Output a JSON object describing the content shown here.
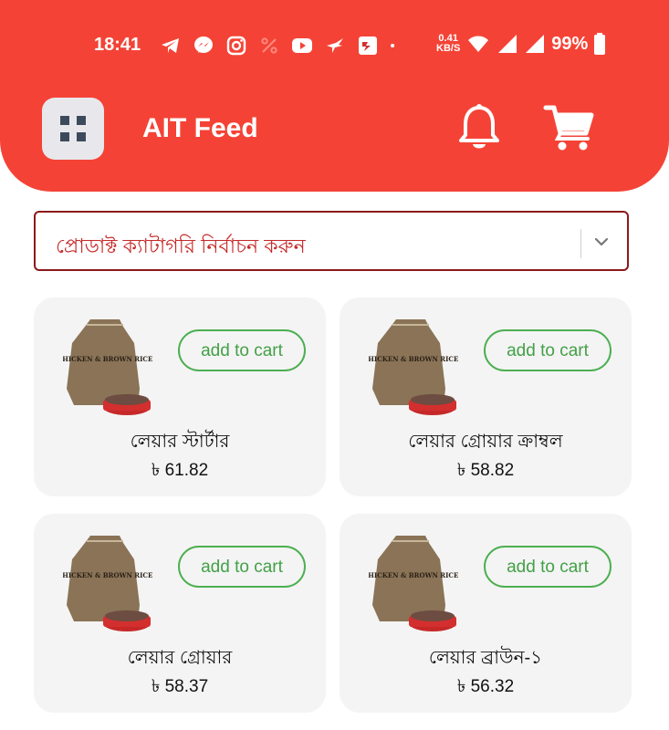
{
  "status_bar": {
    "time": "18:41",
    "net_speed_value": "0.41",
    "net_speed_unit": "KB/S",
    "battery": "99%",
    "icons": [
      "telegram-icon",
      "messenger-icon",
      "instagram-icon",
      "percent-icon",
      "youtube-icon",
      "bird-icon",
      "app-icon",
      "dot-icon",
      "wifi-icon",
      "signal-icon",
      "battery-icon"
    ]
  },
  "header": {
    "title": "AIT Feed",
    "background_color": "#f44336"
  },
  "category": {
    "placeholder": "প্রোডাক্ট ক্যাটাগরি নির্বাচন করুন"
  },
  "products": [
    {
      "name": "লেয়ার স্টার্টার",
      "price": "৳ 61.82",
      "button": "add to cart",
      "bag_text": "CHICKEN & BROWN RICE"
    },
    {
      "name": "লেয়ার গ্রোয়ার ক্রাম্বল",
      "price": "৳ 58.82",
      "button": "add to cart",
      "bag_text": "CHICKEN & BROWN RICE"
    },
    {
      "name": "লেয়ার গ্রোয়ার",
      "price": "৳ 58.37",
      "button": "add to cart",
      "bag_text": "CHICKEN & BROWN RICE"
    },
    {
      "name": "লেয়ার ব্রাউন-১",
      "price": "৳ 56.32",
      "button": "add to cart",
      "bag_text": "CHICKEN & BROWN RICE"
    }
  ],
  "colors": {
    "accent": "#f44336",
    "button_green": "#4caf50",
    "select_border": "#8b1a1a",
    "placeholder_red": "#c62828"
  }
}
